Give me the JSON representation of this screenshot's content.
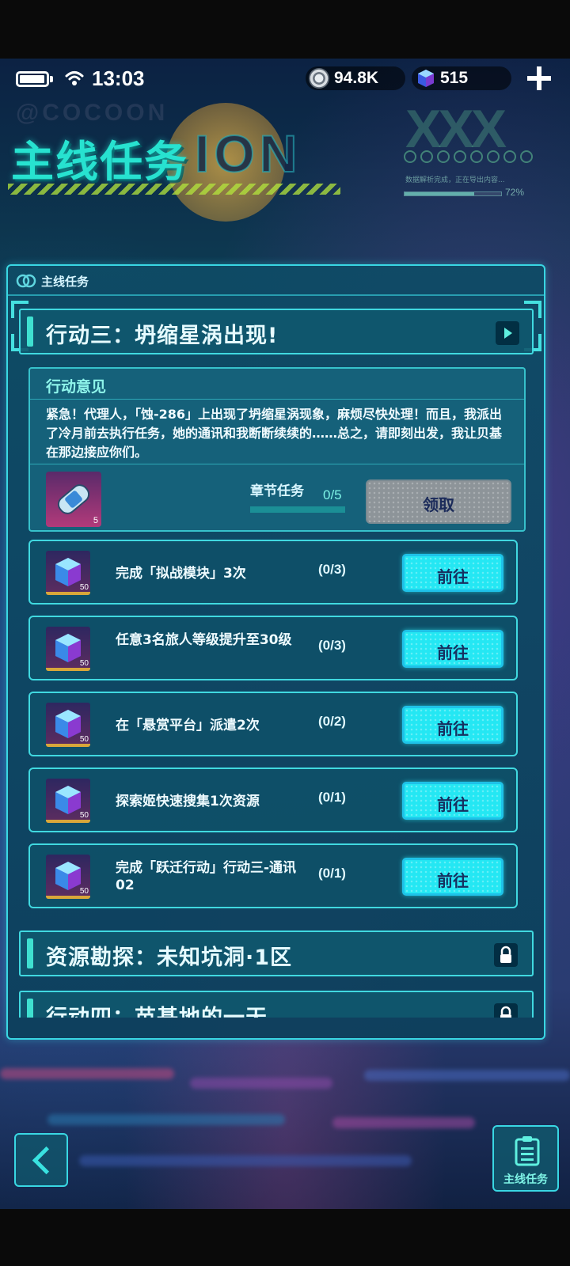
{
  "status": {
    "time": "13:03"
  },
  "currency": {
    "coins": "94.8K",
    "gems": "515"
  },
  "header": {
    "title": "主线任务",
    "brand": "@COCOON",
    "art_text": "ION",
    "deco_text": "XXX",
    "small_text": "数据解析完成，正在导出内容...",
    "progress_label": "72%",
    "progress_value": 0.72
  },
  "panel": {
    "tab_label": "主线任务"
  },
  "chapter_active": {
    "title": "行动三：坍缩星涡出现!"
  },
  "advice": {
    "title": "行动意见",
    "text": "紧急！代理人，「蚀-286」上出现了坍缩星涡现象，麻烦尽快处理！而且，我派出了冷月前去执行任务，她的通讯和我断断续续的……总之，请即刻出发，我让贝基在那边接应你们。",
    "reward_count": "5",
    "section_label": "章节任务",
    "section_progress": "0/5",
    "section_progress_value": 0,
    "claim_label": "领取"
  },
  "tasks": [
    {
      "text": "完成「拟战模块」3次",
      "progress": "(0/3)",
      "reward_count": "50",
      "button": "前往"
    },
    {
      "text": "任意3名旅人等级提升至30级",
      "progress": "(0/3)",
      "reward_count": "50",
      "button": "前往"
    },
    {
      "text": "在「悬赏平台」派遣2次",
      "progress": "(0/2)",
      "reward_count": "50",
      "button": "前往"
    },
    {
      "text": "探索姬快速搜集1次资源",
      "progress": "(0/1)",
      "reward_count": "50",
      "button": "前往"
    },
    {
      "text": "完成「跃迁行动」行动三-通讯02",
      "progress": "(0/1)",
      "reward_count": "50",
      "button": "前往"
    }
  ],
  "locked_chapters": [
    {
      "title": "资源勘探：未知坑洞·1区"
    },
    {
      "title": "行动四：苗基地的一天"
    }
  ],
  "footer": {
    "quest_label": "主线任务"
  },
  "colors": {
    "accent": "#39d7e3",
    "button": "#24e7f3",
    "title": "#27e2d0"
  }
}
